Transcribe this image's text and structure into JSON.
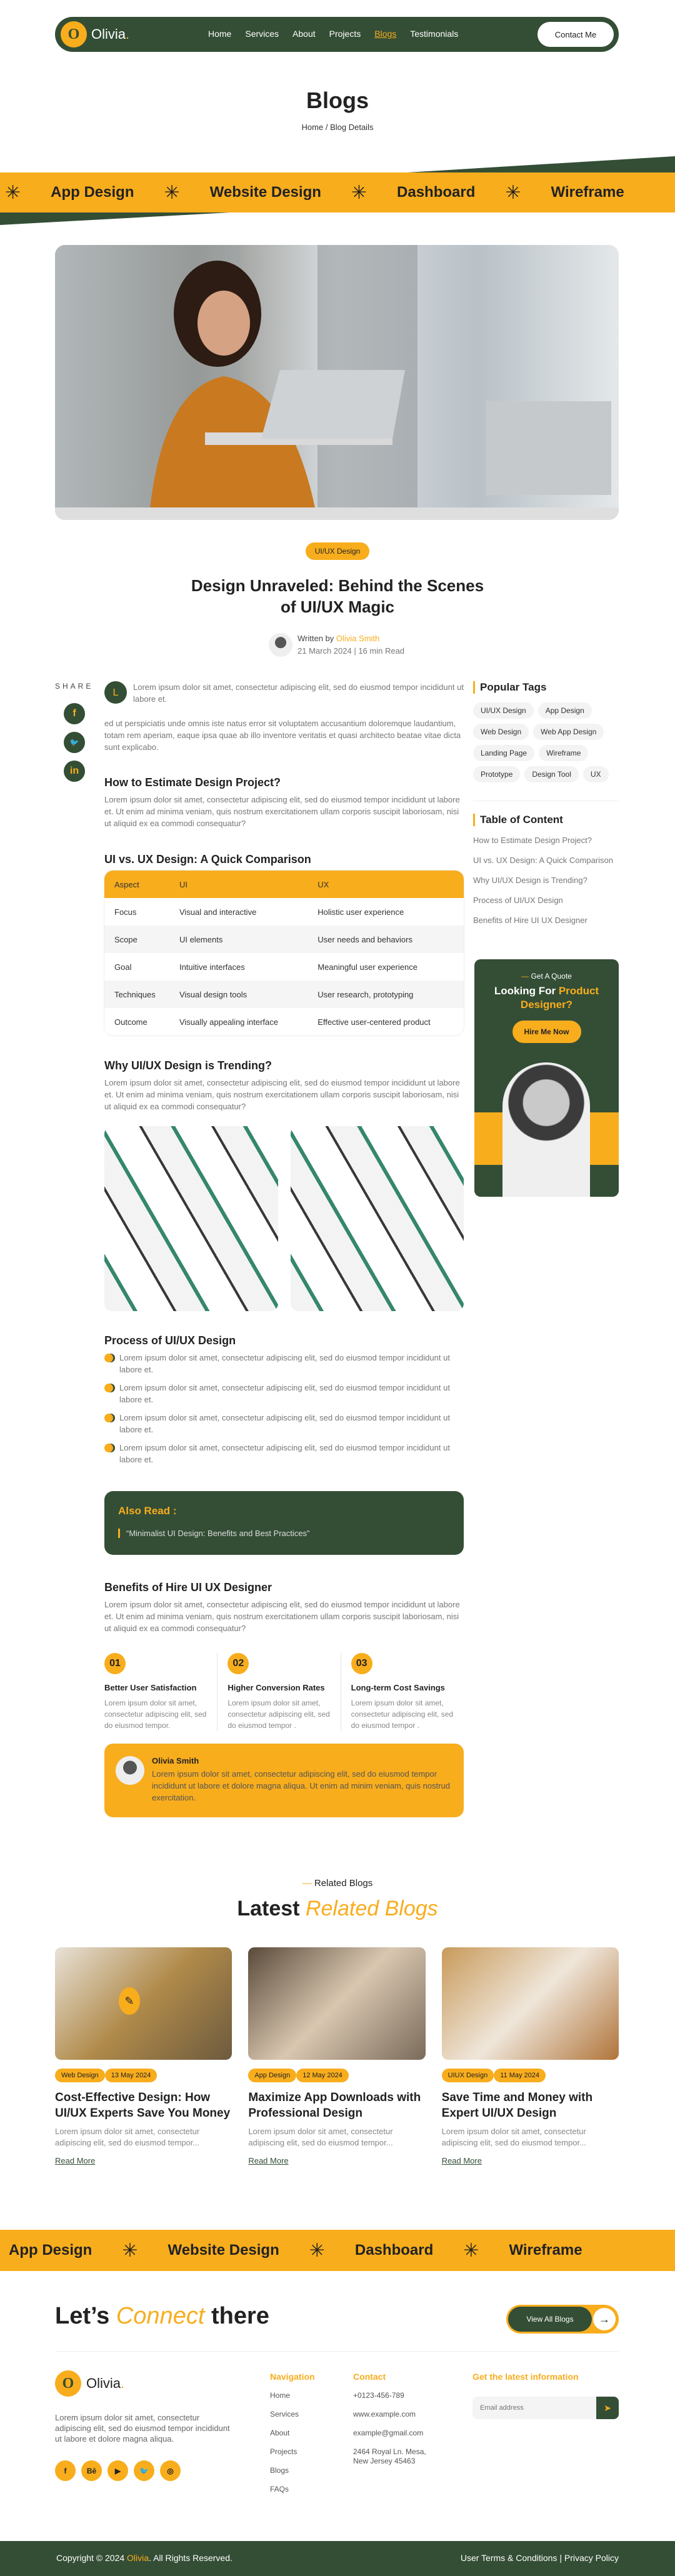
{
  "header": {
    "logo_letter": "O",
    "logo_name": "Olivia",
    "logo_dot": ".",
    "nav": [
      "Home",
      "Services",
      "About",
      "Projects",
      "Blogs",
      "Testimonials"
    ],
    "active_nav": "Blogs",
    "contact_button": "Contact Me"
  },
  "page": {
    "title": "Blogs",
    "breadcrumb": [
      "Home",
      "/",
      "Blog Details"
    ]
  },
  "ribbon_top": [
    "App Design",
    "Website Design",
    "Dashboard",
    "Wireframe"
  ],
  "ribbon_bottom": [
    "App Design",
    "Website Design",
    "Dashboard",
    "Wireframe"
  ],
  "ribbon_icon": "asterisk-icon",
  "post": {
    "category": "UI/UX Design",
    "title": "Design Unraveled: Behind the Scenes of UI/UX Magic",
    "written_by": "Written by",
    "author": "Olivia Smith",
    "meta": "21 March 2024 | 16 min Read"
  },
  "share": {
    "label": "SHARE",
    "icons": [
      "facebook-icon",
      "twitter-icon",
      "linkedin-icon"
    ],
    "glyphs": [
      "f",
      "🐦",
      "in"
    ]
  },
  "article": {
    "dropcap": "L",
    "intro": "Lorem ipsum dolor sit amet, consectetur adipiscing elit, sed do eiusmod tempor incididunt ut labore et.",
    "para2": "ed ut perspiciatis unde omnis iste natus error sit voluptatem accusantium doloremque laudantium, totam rem aperiam, eaque ipsa quae ab illo inventore veritatis et quasi architecto beatae vitae dicta sunt explicabo.",
    "h_estimate": "How to Estimate Design Project?",
    "p_estimate": "Lorem ipsum dolor sit amet, consectetur adipiscing elit, sed do eiusmod tempor incididunt ut labore et. Ut enim ad minima veniam, quis nostrum exercitationem ullam corporis suscipit laboriosam, nisi ut aliquid ex ea commodi consequatur?",
    "h_compare": "UI vs. UX Design: A Quick Comparison",
    "table": {
      "headers": [
        "Aspect",
        "UI",
        "UX"
      ],
      "rows": [
        [
          "Focus",
          "Visual and interactive",
          "Holistic user experience"
        ],
        [
          "Scope",
          "UI elements",
          "User needs and behaviors"
        ],
        [
          "Goal",
          "Intuitive interfaces",
          "Meaningful user experience"
        ],
        [
          "Techniques",
          "Visual design tools",
          "User research, prototyping"
        ],
        [
          "Outcome",
          "Visually appealing interface",
          "Effective user-centered product"
        ]
      ]
    },
    "h_trending": "Why UI/UX Design is Trending?",
    "p_trending": "Lorem ipsum dolor sit amet, consectetur adipiscing elit, sed do eiusmod tempor incididunt ut labore et. Ut enim ad minima veniam, quis nostrum exercitationem ullam corporis suscipit laboriosam, nisi ut aliquid ex ea commodi consequatur?",
    "h_process": "Process of UI/UX Design",
    "process_items": [
      "Lorem ipsum dolor sit amet, consectetur adipiscing elit, sed do eiusmod tempor incididunt ut labore et.",
      "Lorem ipsum dolor sit amet, consectetur adipiscing elit, sed do eiusmod tempor incididunt ut labore et.",
      "Lorem ipsum dolor sit amet, consectetur adipiscing elit, sed do eiusmod tempor incididunt ut labore et.",
      "Lorem ipsum dolor sit amet, consectetur adipiscing elit, sed do eiusmod tempor incididunt ut labore et."
    ],
    "also_read_title": "Also Read :",
    "also_read_quote": "“Minimalist UI Design: Benefits and Best Practices”",
    "h_benefits": "Benefits of Hire UI UX Designer",
    "p_benefits": "Lorem ipsum dolor sit amet, consectetur adipiscing elit, sed do eiusmod tempor incididunt ut labore et. Ut enim ad minima veniam, quis nostrum exercitationem ullam corporis suscipit laboriosam, nisi ut aliquid ex ea commodi consequatur?",
    "benefits": [
      {
        "num": "01",
        "title": "Better User Satisfaction",
        "text": "Lorem ipsum dolor sit amet, consectetur adipiscing elit, sed do eiusmod tempor."
      },
      {
        "num": "02",
        "title": "Higher Conversion Rates",
        "text": "Lorem ipsum dolor sit amet, consectetur adipiscing elit, sed do eiusmod tempor ."
      },
      {
        "num": "03",
        "title": "Long-term Cost Savings",
        "text": "Lorem ipsum dolor sit amet, consectetur adipiscing elit, sed do eiusmod tempor ."
      }
    ],
    "author_box": {
      "name": "Olivia Smith",
      "bio": "Lorem ipsum dolor sit amet, consectetur adipiscing elit, sed do eiusmod tempor incididunt ut labore et dolore magna aliqua. Ut enim ad minim veniam, quis nostrud exercitation."
    }
  },
  "sidebar": {
    "tags_title": "Popular Tags",
    "tags": [
      "UI/UX Design",
      "App Design",
      "Web Design",
      "Web App Design",
      "Landing Page",
      "Wireframe",
      "Prototype",
      "Design Tool",
      "UX"
    ],
    "toc_title": "Table of Content",
    "toc": [
      "How to Estimate Design Project?",
      "UI vs. UX Design: A Quick Comparison",
      "Why UI/UX Design is Trending?",
      "Process of UI/UX Design",
      "Benefits of Hire UI UX Designer"
    ],
    "quote_sub": "Get A Quote",
    "quote_title_a": "Looking For ",
    "quote_title_b": "Product Designer?",
    "hire_button": "Hire Me Now"
  },
  "related": {
    "sub": "Related Blogs",
    "title_a": "Latest ",
    "title_b": "Related Blogs",
    "cards": [
      {
        "tag": "Web Design",
        "date": "13 May 2024",
        "title": "Cost-Effective Design: How UI/UX Experts Save You Money",
        "excerpt": "Lorem ipsum dolor sit amet, consectetur adipiscing elit, sed do eiusmod tempor...",
        "link": "Read More"
      },
      {
        "tag": "App Design",
        "date": "12 May 2024",
        "title": "Maximize App Downloads with Professional Design",
        "excerpt": "Lorem ipsum dolor sit amet, consectetur adipiscing elit, sed do eiusmod tempor...",
        "link": "Read More"
      },
      {
        "tag": "UIUX Design",
        "date": "11 May 2024",
        "title": "Save Time and Money with Expert UI/UX Design",
        "excerpt": "Lorem ipsum dolor sit amet, consectetur adipiscing elit, sed do eiusmod tempor...",
        "link": "Read More"
      }
    ]
  },
  "footer": {
    "connect_a": "Let’s ",
    "connect_b": "Connect",
    "connect_c": " there",
    "view_all": "View All Blogs",
    "arrow": "→",
    "desc": "Lorem ipsum dolor sit amet, consectetur adipiscing elit, sed do eiusmod tempor incididunt ut labore et dolore magna aliqua.",
    "socials": [
      {
        "icon": "facebook-icon",
        "glyph": "f"
      },
      {
        "icon": "behance-icon",
        "glyph": "Bē"
      },
      {
        "icon": "youtube-icon",
        "glyph": "▶"
      },
      {
        "icon": "twitter-icon",
        "glyph": "🐦"
      },
      {
        "icon": "instagram-icon",
        "glyph": "◎"
      }
    ],
    "nav_title": "Navigation",
    "nav": [
      "Home",
      "Services",
      "About",
      "Projects",
      "Blogs",
      "FAQs"
    ],
    "contact_title": "Contact",
    "contact": [
      "+0123-456-789",
      "www.example.com",
      "example@gmail.com",
      "2464 Royal Ln. Mesa, New Jersey 45463"
    ],
    "newsletter_title": "Get the latest information",
    "email_placeholder": "Email address",
    "copyright_a": "Copyright © 2024 ",
    "copyright_brand": "Olivia",
    "copyright_b": ". All Rights Reserved.",
    "terms": "User Terms & Conditions",
    "sep": " | ",
    "privacy": "Privacy Policy"
  },
  "colors": {
    "accent": "#f8ad1d",
    "dark": "#344e36"
  }
}
